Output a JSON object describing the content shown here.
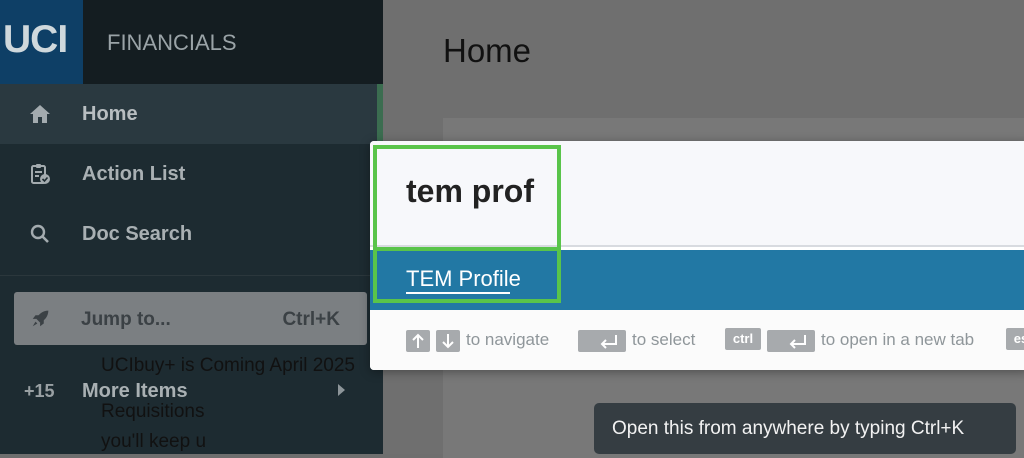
{
  "logo": {
    "text": "UCI"
  },
  "app": {
    "name": "FINANCIALS"
  },
  "sidebar": {
    "items": [
      {
        "label": "Home",
        "icon": "home-icon"
      },
      {
        "label": "Action List",
        "icon": "clipboard-check-icon"
      },
      {
        "label": "Doc Search",
        "icon": "search-icon"
      }
    ],
    "jump": {
      "label": "Jump to...",
      "shortcut": "Ctrl+K",
      "icon": "rocket-icon"
    },
    "more": {
      "count": "+15",
      "label": "More Items"
    }
  },
  "main": {
    "title": "Home",
    "content": {
      "line1": "UCIbuy+ is Coming April 2025",
      "line2": "Requisitions",
      "line3": "you'll keep u"
    }
  },
  "palette": {
    "query": "tem prof",
    "result": "TEM Profile",
    "hints": {
      "navigate": "to navigate",
      "select": "to select",
      "ctrl_key": "ctrl",
      "new_tab": "to open in a new tab",
      "esc_key": "es"
    }
  },
  "tooltip": {
    "text": "Open this from anywhere by typing Ctrl+K"
  },
  "colors": {
    "accent": "#2278a4",
    "highlight": "#59c44a"
  }
}
